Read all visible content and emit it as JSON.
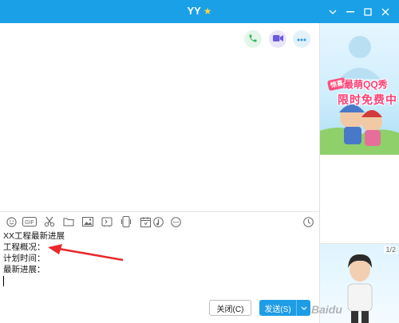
{
  "window": {
    "title": "YY",
    "title_icon": "star-icon"
  },
  "window_controls": {
    "dropdown": "chevron-down-icon",
    "minimize": "minimize-icon",
    "maximize": "maximize-icon",
    "close": "close-icon"
  },
  "chat_actions": {
    "call": "phone-icon",
    "video": "video-camera-icon",
    "more": "more-dots-icon"
  },
  "toolbar": {
    "tools": [
      "emoji-icon",
      "gif-icon",
      "scissors-icon",
      "folder-icon",
      "image-icon",
      "phone-screen-icon",
      "calendar-icon",
      "audio-icon",
      "more-icon"
    ],
    "history": "clock-icon"
  },
  "editor": {
    "lines": [
      "XX工程最新进展",
      "工程概况：",
      "计划时间：",
      "最新进展："
    ]
  },
  "buttons": {
    "close_label": "关闭(C)",
    "send_label": "发送(S)"
  },
  "sidebar": {
    "ad_top": {
      "badge": "惊喜",
      "line1": "最萌QQ秀",
      "line2": "限时免费中"
    },
    "ad_bottom": {
      "page": "1/2"
    }
  },
  "watermark": "Baidu",
  "colors": {
    "titlebar": "#1aa0e6",
    "send_button": "#1e9de6",
    "call": "#2fb45a",
    "video": "#6a5ae0",
    "more": "#2b9be0",
    "arrow": "#e8282c"
  }
}
